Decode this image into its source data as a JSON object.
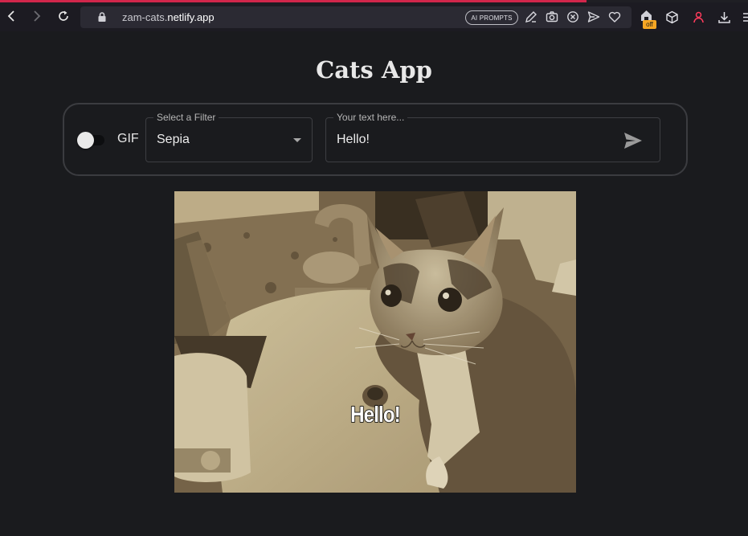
{
  "browser": {
    "url_domain": "zam-cats.",
    "url_host": "netlify.app",
    "ai_pill": "AI PROMPTS",
    "off_badge": "off",
    "accent_color": "#d1264b"
  },
  "icons": [
    "back-icon",
    "forward-icon",
    "reload-icon",
    "lock-icon",
    "edit-icon",
    "camera-icon",
    "close-circle-icon",
    "send-icon",
    "heart-icon",
    "extension-home-icon",
    "cube-icon",
    "account-icon",
    "download-icon",
    "menu-icon"
  ],
  "app": {
    "title": "Cats App",
    "gif_label": "GIF",
    "gif_enabled": false,
    "filter": {
      "legend": "Select a Filter",
      "value": "Sepia"
    },
    "text_input": {
      "legend": "Your text here...",
      "value": "Hello!"
    },
    "image_caption": "Hello!"
  }
}
